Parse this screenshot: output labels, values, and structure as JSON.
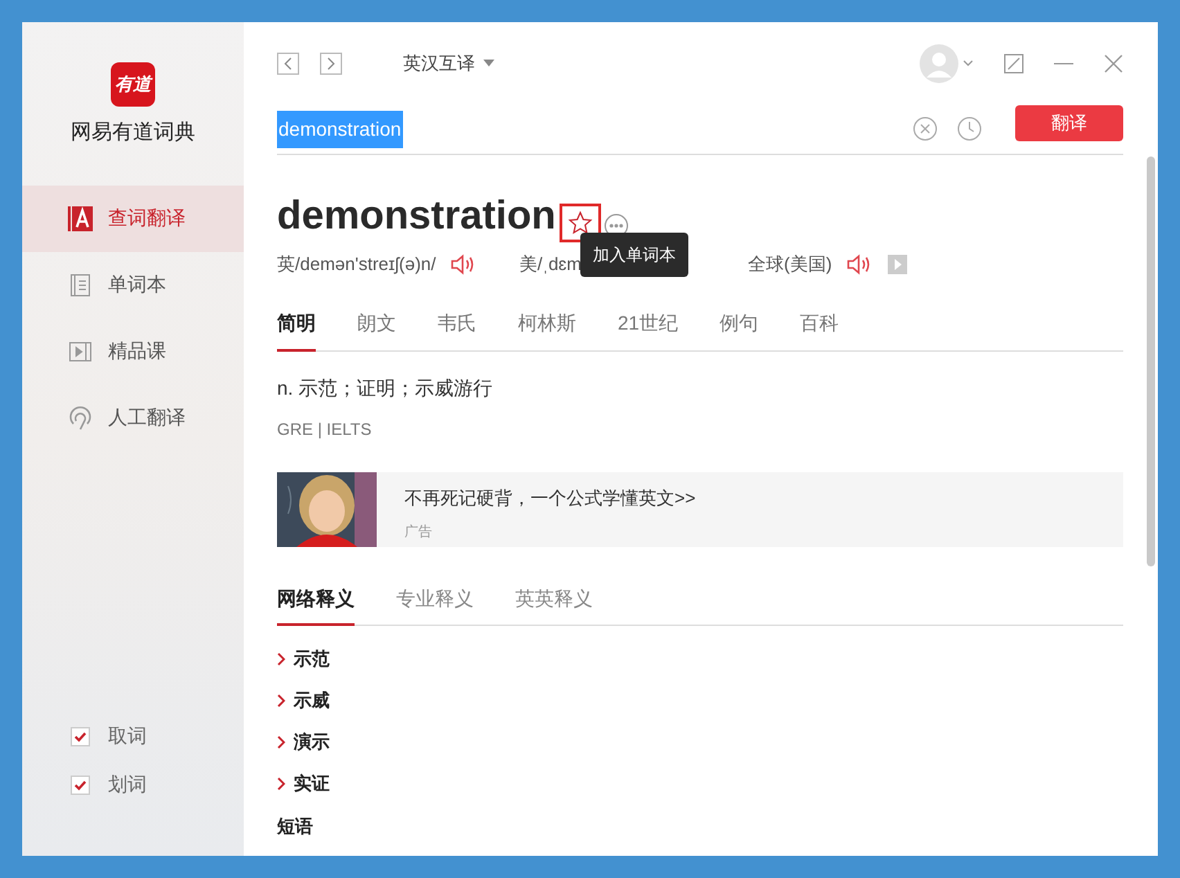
{
  "app": {
    "logo": "有道",
    "name": "网易有道词典"
  },
  "sidebar": {
    "items": [
      {
        "label": "查词翻译",
        "selected": true
      },
      {
        "label": "单词本",
        "selected": false
      },
      {
        "label": "精品课",
        "selected": false
      },
      {
        "label": "人工翻译",
        "selected": false
      }
    ]
  },
  "options": [
    {
      "label": "取词",
      "checked": true
    },
    {
      "label": "划词",
      "checked": true
    }
  ],
  "header": {
    "language_mode": "英汉互译"
  },
  "search": {
    "value": "demonstration",
    "text_selected": true
  },
  "translate_button": "翻译",
  "entry": {
    "word": "demonstration",
    "tooltip": "加入单词本",
    "pronunciations": [
      {
        "text": "英/demən'streɪʃ(ə)n/"
      },
      {
        "text": "美/ˌdɛm"
      },
      {
        "text": "全球(美国)"
      }
    ],
    "tabs": [
      {
        "label": "简明",
        "selected": true
      },
      {
        "label": "朗文",
        "selected": false
      },
      {
        "label": "韦氏",
        "selected": false
      },
      {
        "label": "柯林斯",
        "selected": false
      },
      {
        "label": "21世纪",
        "selected": false
      },
      {
        "label": "例句",
        "selected": false
      },
      {
        "label": "百科",
        "selected": false
      }
    ],
    "definition": "n. 示范；证明；示威游行",
    "exam_tags": "GRE | IELTS"
  },
  "ad": {
    "text": "不再死记硬背，一个公式学懂英文>>",
    "label": "广告"
  },
  "meaning_tabs": [
    {
      "label": "网络释义",
      "selected": true
    },
    {
      "label": "专业释义",
      "selected": false
    },
    {
      "label": "英英释义",
      "selected": false
    }
  ],
  "web_meanings": [
    {
      "text": "示范"
    },
    {
      "text": "示威"
    },
    {
      "text": "演示"
    },
    {
      "text": "实证"
    }
  ],
  "phrases_heading": "短语"
}
